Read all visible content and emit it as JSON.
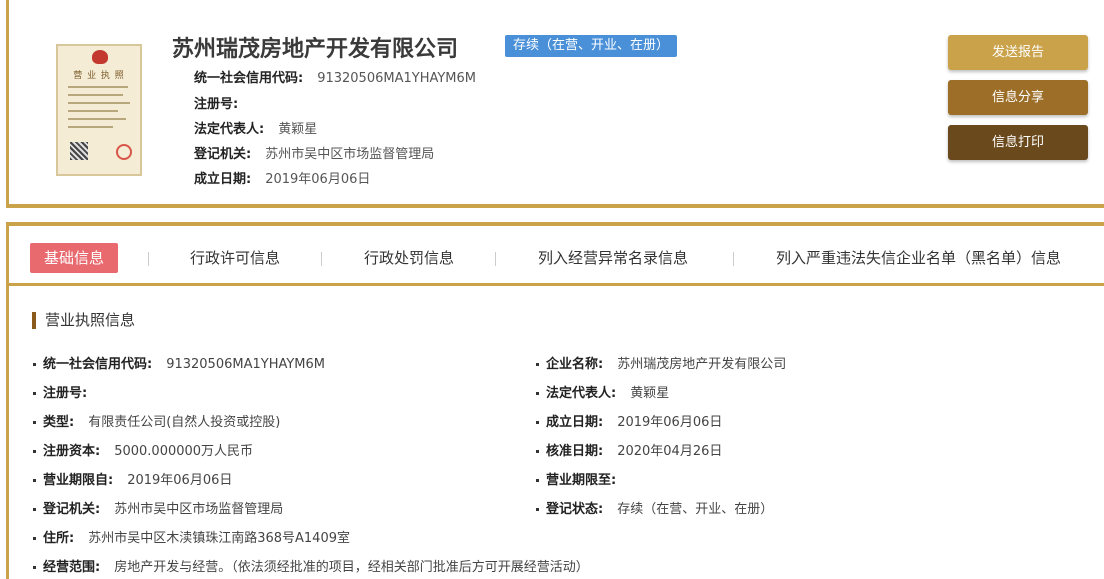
{
  "header": {
    "company_name": "苏州瑞茂房地产开发有限公司",
    "status": "存续（在营、开业、在册）",
    "license_title": "营 业 执 照",
    "fields": [
      {
        "label": "统一社会信用代码:",
        "value": "91320506MA1YHAYM6M"
      },
      {
        "label": "注册号:",
        "value": ""
      },
      {
        "label": "法定代表人:",
        "value": "黄颖星"
      },
      {
        "label": "登记机关:",
        "value": "苏州市吴中区市场监督管理局"
      },
      {
        "label": "成立日期:",
        "value": "2019年06月06日"
      }
    ]
  },
  "actions": {
    "send_report": "发送报告",
    "share": "信息分享",
    "print": "信息打印"
  },
  "tabs": [
    {
      "label": "基础信息"
    },
    {
      "label": "行政许可信息"
    },
    {
      "label": "行政处罚信息"
    },
    {
      "label": "列入经营异常名录信息"
    },
    {
      "label": "列入严重违法失信企业名单（黑名单）信息"
    }
  ],
  "section_title": "营业执照信息",
  "details": {
    "left": [
      {
        "label": "统一社会信用代码:",
        "value": "91320506MA1YHAYM6M"
      },
      {
        "label": "注册号:",
        "value": ""
      },
      {
        "label": "类型:",
        "value": "有限责任公司(自然人投资或控股)"
      },
      {
        "label": "注册资本:",
        "value": "5000.000000万人民币"
      },
      {
        "label": "营业期限自:",
        "value": "2019年06月06日"
      },
      {
        "label": "登记机关:",
        "value": "苏州市吴中区市场监督管理局"
      },
      {
        "label": "住所:",
        "value": "苏州市吴中区木渎镇珠江南路368号A1409室"
      },
      {
        "label": "经营范围:",
        "value": "房地产开发与经营。（依法须经批准的项目，经相关部门批准后方可开展经营活动）"
      }
    ],
    "right": [
      {
        "label": "企业名称:",
        "value": "苏州瑞茂房地产开发有限公司"
      },
      {
        "label": "法定代表人:",
        "value": "黄颖星"
      },
      {
        "label": "成立日期:",
        "value": "2019年06月06日"
      },
      {
        "label": "核准日期:",
        "value": "2020年04月26日"
      },
      {
        "label": "营业期限至:",
        "value": ""
      },
      {
        "label": "登记状态:",
        "value": "存续（在营、开业、在册）"
      }
    ]
  },
  "colors": {
    "gold": "#c9a24a",
    "brown": "#9c6e28",
    "dark_brown": "#6a4a1c",
    "active_tab": "#e86a6f",
    "status_badge": "#4a90d9"
  }
}
